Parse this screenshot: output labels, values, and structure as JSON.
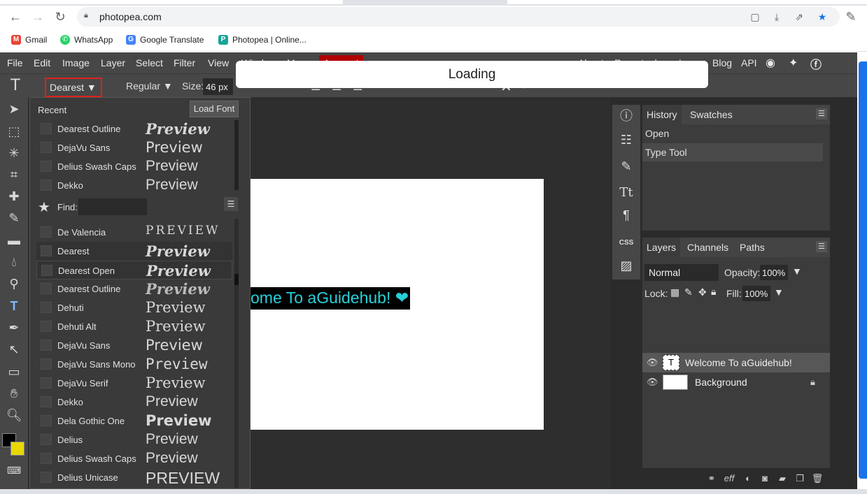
{
  "browser": {
    "url": "photopea.com",
    "bookmarks": [
      {
        "label": "Gmail",
        "icon": "gmail-icon",
        "color": "#ea4335"
      },
      {
        "label": "WhatsApp",
        "icon": "whatsapp-icon",
        "color": "#25d366"
      },
      {
        "label": "Google Translate",
        "icon": "google-translate-icon",
        "color": "#4285f4"
      },
      {
        "label": "Photopea | Online...",
        "icon": "photopea-icon",
        "color": "#18a497"
      }
    ]
  },
  "menu": [
    "File",
    "Edit",
    "Image",
    "Layer",
    "Select",
    "Filter",
    "View",
    "Window",
    "More",
    "Account",
    "About",
    "Report a bug",
    "Learn",
    "Blog",
    "API"
  ],
  "options": {
    "font": "Dearest ▼",
    "style": "Regular ▼",
    "size_label": "Size:",
    "size_value": "46 px"
  },
  "loading": "Loading",
  "font_panel": {
    "recent_label": "Recent",
    "load_font": "Load Font",
    "find_label": "Find:",
    "recent": [
      {
        "name": "Dearest Outline",
        "preview": "Preview"
      },
      {
        "name": "DejaVu Sans",
        "preview": "Preview"
      },
      {
        "name": "Delius Swash Caps",
        "preview": "Preview"
      },
      {
        "name": "Dekko",
        "preview": "Preview"
      }
    ],
    "list": [
      {
        "name": "De Valencia",
        "preview": "PREVIEW"
      },
      {
        "name": "Dearest",
        "preview": "Preview"
      },
      {
        "name": "Dearest Open",
        "preview": "Preview"
      },
      {
        "name": "Dearest Outline",
        "preview": "Preview"
      },
      {
        "name": "Dehuti",
        "preview": "Preview"
      },
      {
        "name": "Dehuti Alt",
        "preview": "Preview"
      },
      {
        "name": "DejaVu Sans",
        "preview": "Preview"
      },
      {
        "name": "DejaVu Sans Mono",
        "preview": "Preview"
      },
      {
        "name": "DejaVu Serif",
        "preview": "Preview"
      },
      {
        "name": "Dekko",
        "preview": "Preview"
      },
      {
        "name": "Dela Gothic One",
        "preview": "Preview"
      },
      {
        "name": "Delius",
        "preview": "Preview"
      },
      {
        "name": "Delius Swash Caps",
        "preview": "Preview"
      },
      {
        "name": "Delius Unicase",
        "preview": "PREVIEW"
      }
    ]
  },
  "canvas": {
    "text": "ome To aGuidehub! ❤"
  },
  "history": {
    "tabs": [
      "History",
      "Swatches"
    ],
    "items": [
      "Open",
      "Type Tool"
    ]
  },
  "layers": {
    "tabs": [
      "Layers",
      "Channels",
      "Paths"
    ],
    "blend": "Normal",
    "opacity_label": "Opacity:",
    "opacity": "100%",
    "lock_label": "Lock:",
    "fill_label": "Fill:",
    "fill": "100%",
    "items": [
      {
        "name": "Welcome To aGuidehub!"
      },
      {
        "name": "Background"
      }
    ]
  },
  "colors": {
    "accent_red": "#e0201b",
    "text_cyan": "#27d0d8"
  }
}
